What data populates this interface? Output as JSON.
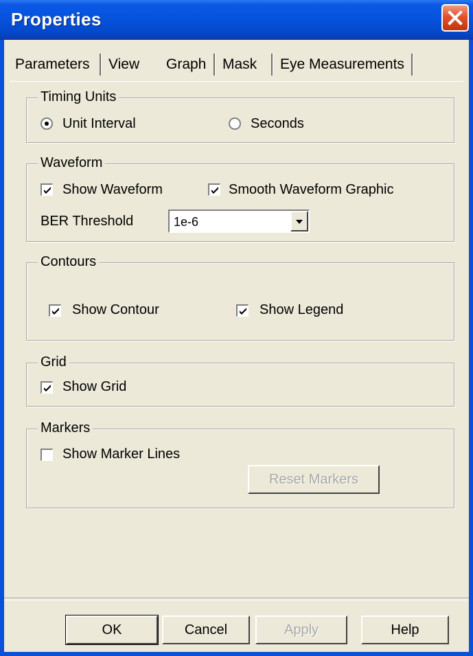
{
  "window": {
    "title": "Properties"
  },
  "tabs": [
    {
      "label": "Parameters"
    },
    {
      "label": "View"
    },
    {
      "label": "Graph",
      "active": true
    },
    {
      "label": "Mask"
    },
    {
      "label": "Eye Measurements"
    }
  ],
  "timing_units": {
    "legend": "Timing Units",
    "options": [
      {
        "label": "Unit Interval",
        "checked": true
      },
      {
        "label": "Seconds",
        "checked": false
      }
    ]
  },
  "waveform": {
    "legend": "Waveform",
    "show_waveform": {
      "label": "Show Waveform",
      "checked": true
    },
    "smooth_waveform": {
      "label": "Smooth Waveform Graphic",
      "checked": true
    },
    "ber_threshold_label": "BER Threshold",
    "ber_threshold_value": "1e-6"
  },
  "contours": {
    "legend": "Contours",
    "show_contour": {
      "label": "Show Contour",
      "checked": true
    },
    "show_legend": {
      "label": "Show Legend",
      "checked": true
    }
  },
  "grid": {
    "legend": "Grid",
    "show_grid": {
      "label": "Show Grid",
      "checked": true
    }
  },
  "markers": {
    "legend": "Markers",
    "show_marker_lines": {
      "label": "Show Marker Lines",
      "checked": false
    },
    "reset_markers_label": "Reset Markers"
  },
  "buttons": {
    "ok": "OK",
    "cancel": "Cancel",
    "apply": "Apply",
    "help": "Help"
  },
  "icons": {
    "close": "close-icon",
    "dropdown": "chevron-down-icon",
    "check": "check-icon"
  },
  "colors": {
    "title_bar": "#0552dc",
    "close_button": "#e2522c",
    "dialog_bg": "#ece9d8"
  }
}
